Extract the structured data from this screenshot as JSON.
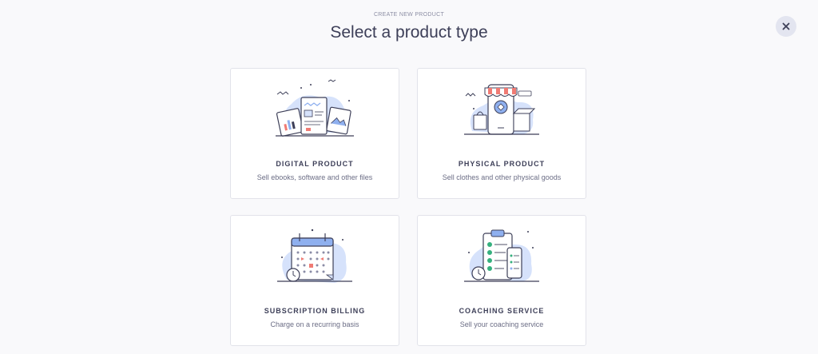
{
  "header": {
    "eyebrow": "CREATE NEW PRODUCT",
    "title": "Select a product type",
    "close_icon": "close-icon"
  },
  "cards": [
    {
      "title": "DIGITAL PRODUCT",
      "description": "Sell ebooks, software and other files",
      "icon": "digital-product-illustration"
    },
    {
      "title": "PHYSICAL PRODUCT",
      "description": "Sell clothes and other physical goods",
      "icon": "physical-product-illustration"
    },
    {
      "title": "SUBSCRIPTION BILLING",
      "description": "Charge on a recurring basis",
      "icon": "subscription-billing-illustration"
    },
    {
      "title": "COACHING SERVICE",
      "description": "Sell your coaching service",
      "icon": "coaching-service-illustration"
    }
  ],
  "colors": {
    "background": "#f9f9fb",
    "card": "#ffffff",
    "border": "#e2e3ea",
    "text": "#3d3f58",
    "muted": "#6b6d85",
    "accent_blue": "#d6e2fb",
    "accent_red": "#f07b74",
    "accent_green": "#35b07e"
  }
}
